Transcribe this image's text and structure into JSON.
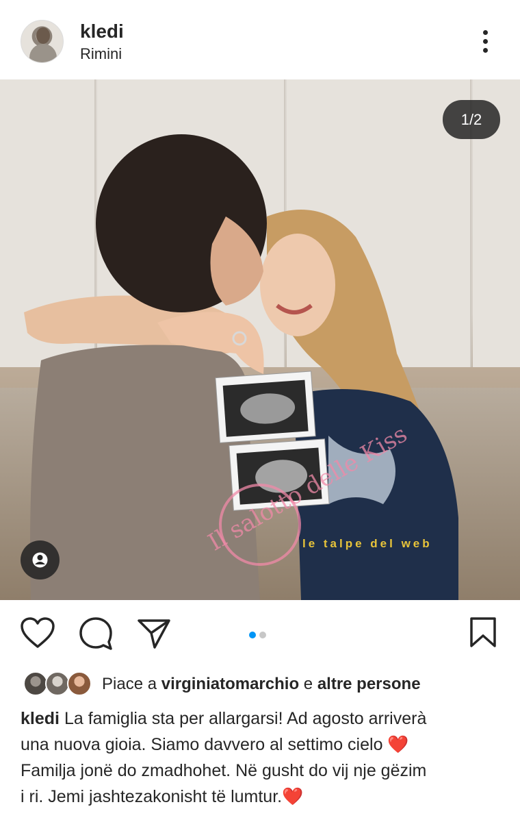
{
  "post": {
    "username": "kledi",
    "location": "Rimini",
    "image_counter": "1/2",
    "carousel": {
      "total": 2,
      "active": 1
    }
  },
  "likes": {
    "prefix": "Piace a",
    "user": "virginiatomarchio",
    "joiner": "e",
    "others": "altre persone"
  },
  "caption": {
    "username": "kledi",
    "lines": [
      "La famiglia sta per allargarsi! Ad agosto arriverà",
      "una nuova gioia. Siamo davvero al settimo cielo",
      "Familja jonë do zmadhohet. Në gusht do vij nje gëzim",
      "i ri. Jemi jashtezakonisht të lumtur."
    ]
  },
  "photo_overlay_text": {
    "watermark_left": "Il salotto delle Kiss",
    "watermark_right": "le talpe del web"
  },
  "icons": [
    "more-icon",
    "user-tag-icon",
    "heart-icon",
    "comment-icon",
    "share-icon",
    "bookmark-icon"
  ],
  "colors": {
    "text": "#262626",
    "active_dot": "#0095f6",
    "inactive_dot": "#c7c7c7",
    "heart_red": "#e02424"
  }
}
